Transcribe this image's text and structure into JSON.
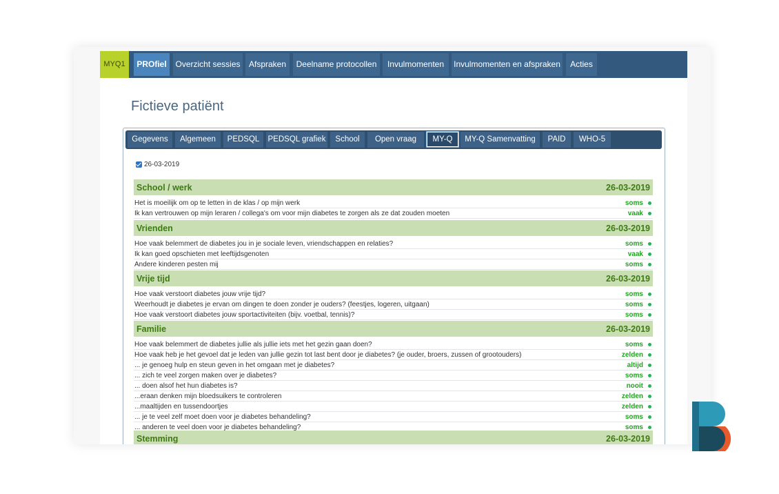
{
  "topnav": {
    "logo": "MYQ1",
    "items": [
      "PROfiel",
      "Overzicht sessies",
      "Afspraken",
      "Deelname protocollen",
      "Invulmomenten",
      "Invulmomenten en afspraken",
      "Acties"
    ]
  },
  "page_title": "Fictieve patiënt",
  "subnav": {
    "tabs": [
      "Gegevens",
      "Algemeen",
      "PEDSQL",
      "PEDSQL grafiek",
      "School",
      "Open vraag",
      "MY-Q",
      "MY-Q Samenvatting",
      "PAID",
      "WHO-5"
    ],
    "active": "MY-Q"
  },
  "date_filter": {
    "label": "26-03-2019",
    "checked": true
  },
  "sections": [
    {
      "title": "School / werk",
      "date": "26-03-2019",
      "rows": [
        {
          "q": "Het is moeilijk om op te letten in de klas / op mijn werk",
          "a": "soms"
        },
        {
          "q": "Ik kan vertrouwen op mijn leraren / collega's om voor mijn diabetes te zorgen als ze dat zouden moeten",
          "a": "vaak"
        }
      ]
    },
    {
      "title": "Vrienden",
      "date": "26-03-2019",
      "rows": [
        {
          "q": "Hoe vaak belemmert de diabetes jou in je sociale leven, vriendschappen en relaties?",
          "a": "soms"
        },
        {
          "q": "Ik kan goed opschieten met leeftijdsgenoten",
          "a": "vaak"
        },
        {
          "q": "Andere kinderen pesten mij",
          "a": "soms"
        }
      ]
    },
    {
      "title": "Vrije tijd",
      "date": "26-03-2019",
      "rows": [
        {
          "q": "Hoe vaak verstoort diabetes jouw vrije tijd?",
          "a": "soms"
        },
        {
          "q": "Weerhoudt je diabetes je ervan om dingen te doen zonder je ouders? (feestjes, logeren, uitgaan)",
          "a": "soms"
        },
        {
          "q": "Hoe vaak verstoort diabetes jouw sportactiviteiten (bijv. voetbal, tennis)?",
          "a": "soms"
        }
      ]
    },
    {
      "title": "Familie",
      "date": "26-03-2019",
      "rows": [
        {
          "q": "Hoe vaak belemmert de diabetes jullie als jullie iets met het gezin gaan doen?",
          "a": "soms"
        },
        {
          "q": "Hoe vaak heb je het gevoel dat je leden van jullie gezin tot last bent door je diabetes? (je ouder, broers, zussen of grootouders)",
          "a": "zelden"
        },
        {
          "q": "... je genoeg hulp en steun geven in het omgaan met je diabetes?",
          "a": "altijd"
        },
        {
          "q": "... zich te veel zorgen maken over je diabetes?",
          "a": "soms"
        },
        {
          "q": "... doen alsof het hun diabetes is?",
          "a": "nooit"
        },
        {
          "q": "...eraan denken mijn bloedsuikers te controleren",
          "a": "zelden"
        },
        {
          "q": "...maaltijden en tussendoortjes",
          "a": "zelden"
        },
        {
          "q": "... je te veel zelf moet doen voor je diabetes behandeling?",
          "a": "soms"
        },
        {
          "q": "... anderen te veel doen voor je diabetes behandeling?",
          "a": "soms"
        }
      ]
    },
    {
      "title": "Stemming",
      "date": "26-03-2019",
      "rows": []
    }
  ],
  "colors": {
    "nav": "#34597f",
    "accent": "#b9d22b",
    "section": "#c9dfb3",
    "answer": "#1fa51f"
  },
  "icons": [
    "checkbox-icon",
    "status-dot-icon",
    "brand-logo-icon"
  ]
}
